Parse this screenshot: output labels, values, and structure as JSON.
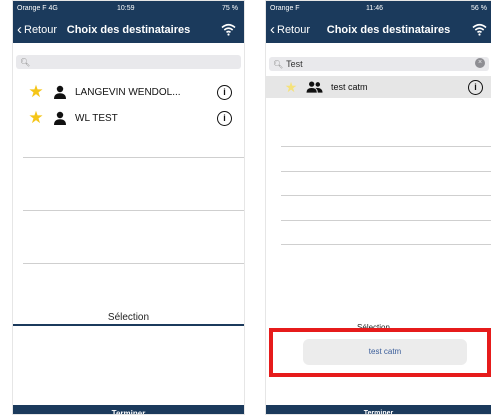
{
  "left": {
    "status": {
      "carrier": "Orange F  4G",
      "time": "10:59",
      "battery": "75 %"
    },
    "nav": {
      "back": "Retour",
      "title": "Choix des destinataires",
      "icon": "wifi-icon"
    },
    "search": {
      "placeholder": "",
      "icon": "search-icon"
    },
    "rows": [
      {
        "label": "LANGEVIN WENDOL...",
        "star_color": "#f5c518"
      },
      {
        "label": "WL TEST",
        "star_color": "#f5c518"
      }
    ],
    "selection_title": "Sélection",
    "footer": "Terminer"
  },
  "right": {
    "status": {
      "carrier": "Orange F",
      "time": "11:46",
      "battery": "56 %"
    },
    "nav": {
      "back": "Retour",
      "title": "Choix des destinataires",
      "icon": "wifi-icon"
    },
    "search": {
      "value": "Test",
      "icon": "search-icon",
      "clear_icon": "clear-icon"
    },
    "rows": [
      {
        "label": "test catm",
        "star_color": "#f5e27a"
      }
    ],
    "selection_title": "Sélection",
    "chip": "test catm",
    "footer": "Terminer",
    "highlight_color": "#e61b1b"
  },
  "colors": {
    "bar": "#1b3a5c",
    "accent": "#3a5d9a"
  }
}
